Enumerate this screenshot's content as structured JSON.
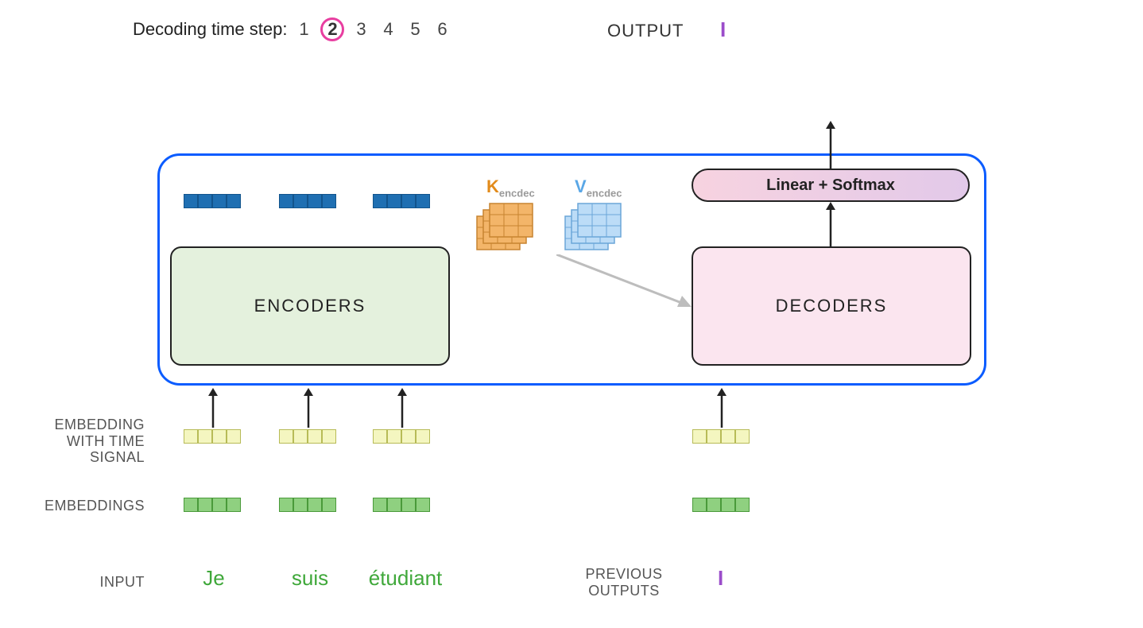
{
  "header": {
    "timestep_label": "Decoding time step:",
    "steps": [
      "1",
      "2",
      "3",
      "4",
      "5",
      "6"
    ],
    "current_step": "2",
    "output_label": "OUTPUT",
    "output_token": "I"
  },
  "kv": {
    "k_letter": "K",
    "k_sub": "encdec",
    "v_letter": "V",
    "v_sub": "encdec"
  },
  "blocks": {
    "encoders": "ENCODERS",
    "decoders": "DECODERS",
    "linear_softmax": "Linear + Softmax"
  },
  "rows": {
    "embedding_time": "EMBEDDING\nWITH TIME\nSIGNAL",
    "embeddings": "EMBEDDINGS",
    "input": "INPUT",
    "previous_outputs": "PREVIOUS\nOUTPUTS"
  },
  "input_tokens": [
    "Je",
    "suis",
    "étudiant"
  ],
  "decoder_prev_token": "I",
  "colors": {
    "model_border": "#0b5cff",
    "highlight": "#e83ea0",
    "encoder_bg": "#e4f1dd",
    "decoder_bg": "#fbe5ef"
  }
}
